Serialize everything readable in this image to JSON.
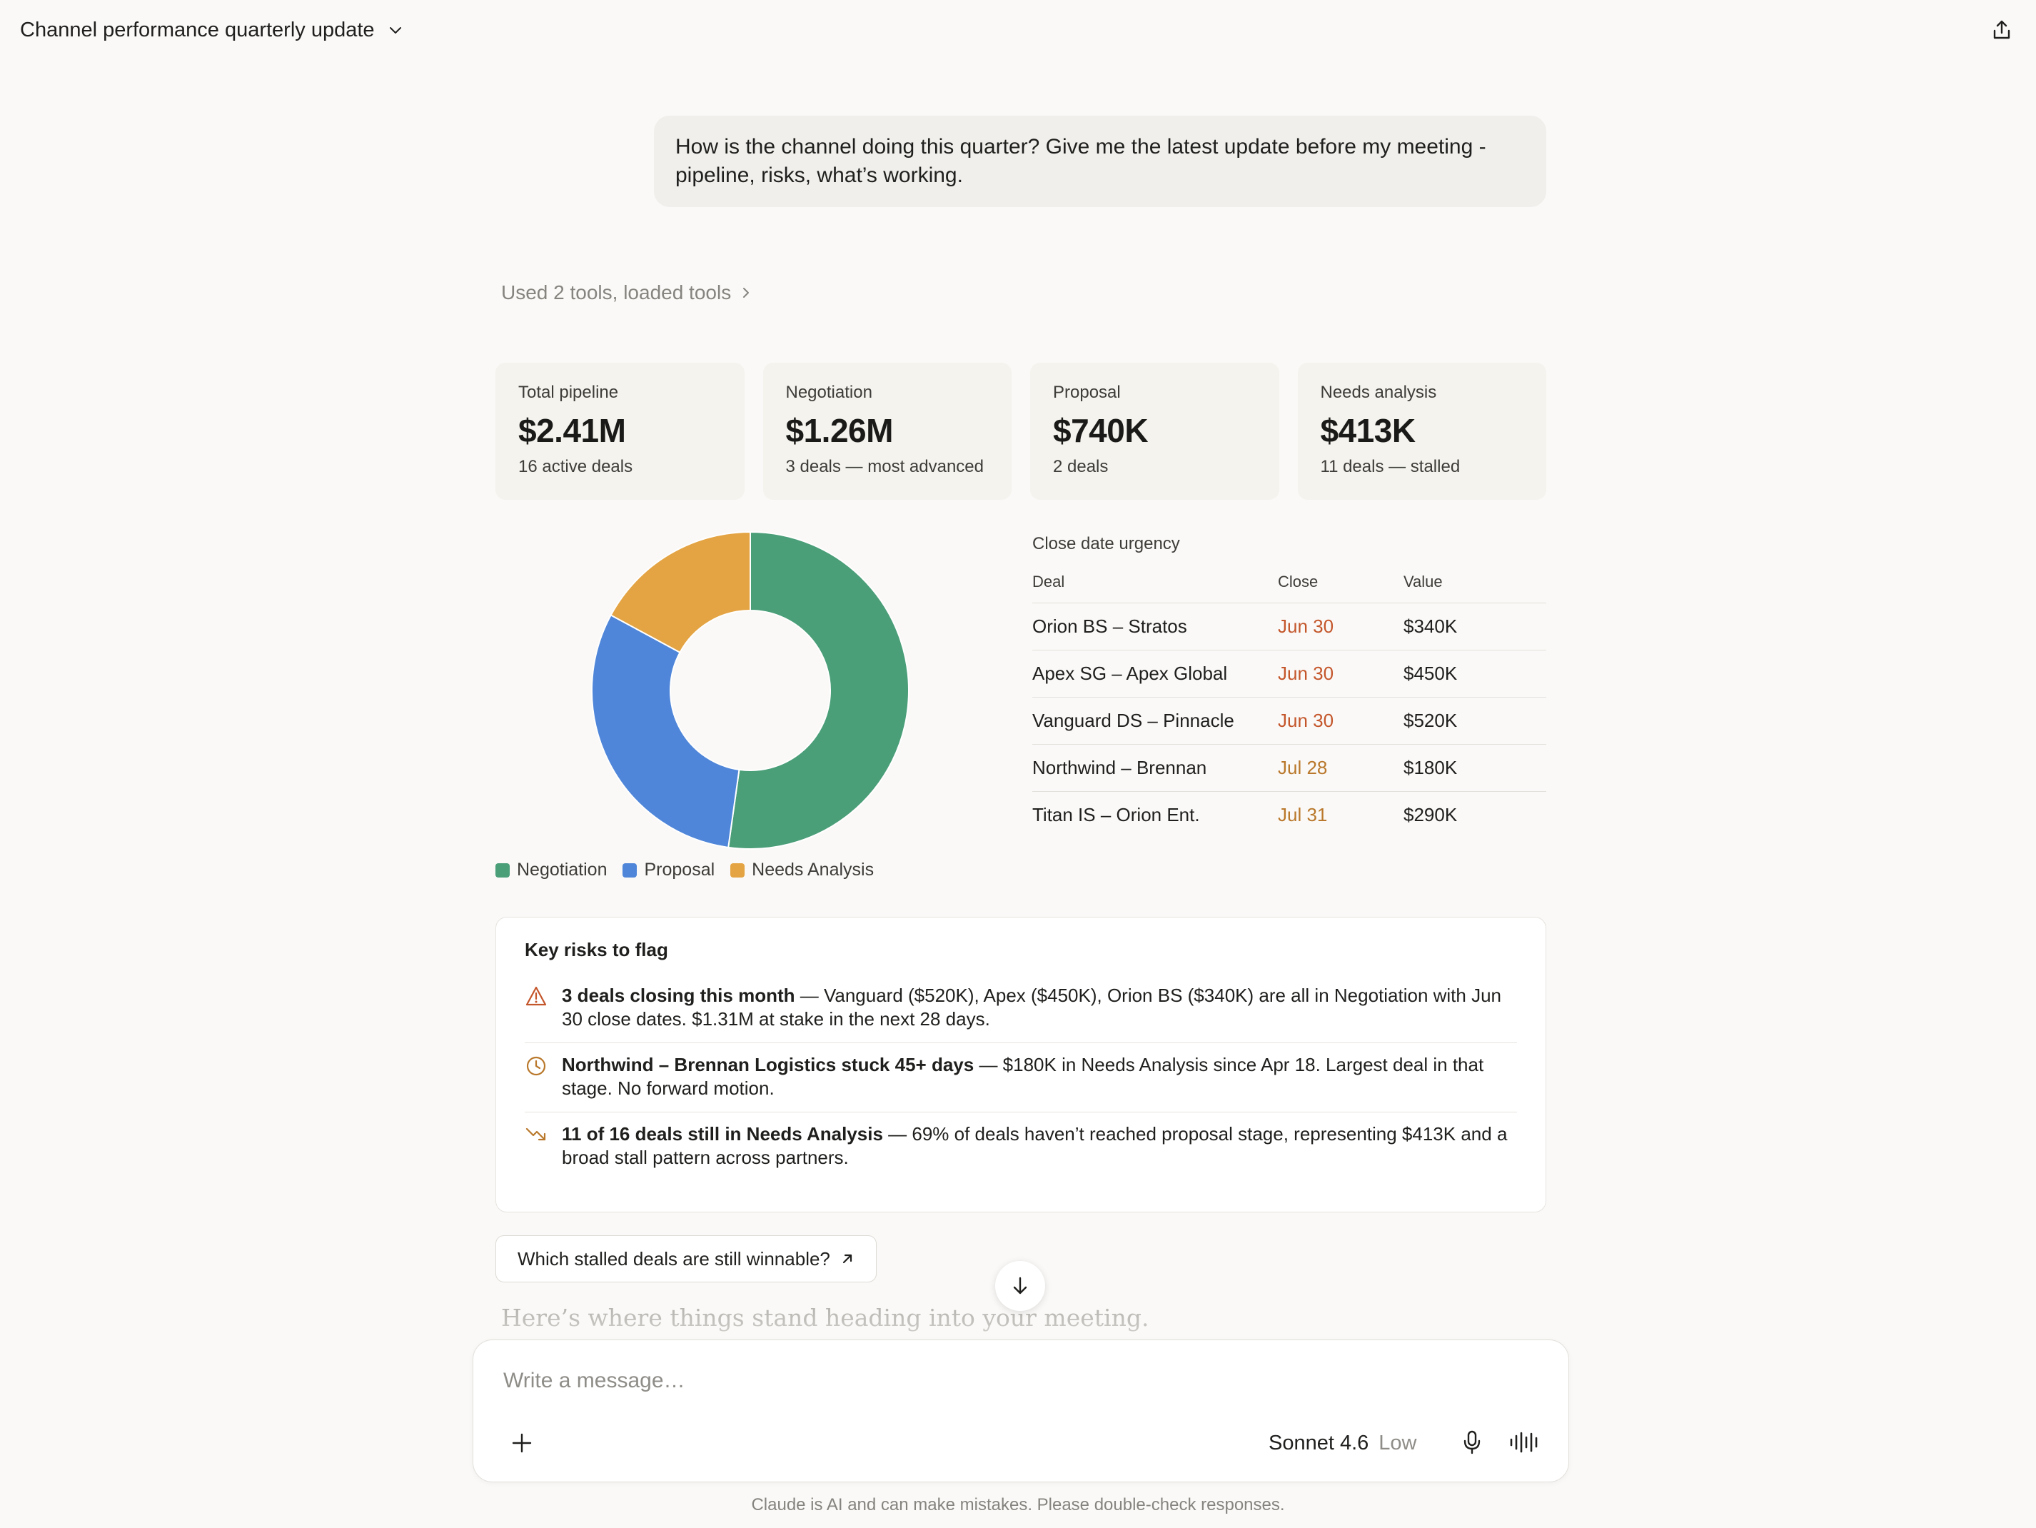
{
  "header": {
    "title": "Channel performance quarterly update"
  },
  "user_message": "How is the channel doing this quarter? Give me the latest update before my meeting - pipeline, risks, what’s working.",
  "tools_summary": "Used 2 tools, loaded tools",
  "kpis": [
    {
      "label": "Total pipeline",
      "value": "$2.41M",
      "sub": "16 active deals"
    },
    {
      "label": "Negotiation",
      "value": "$1.26M",
      "sub": "3 deals — most advanced"
    },
    {
      "label": "Proposal",
      "value": "$740K",
      "sub": "2 deals"
    },
    {
      "label": "Needs analysis",
      "value": "$413K",
      "sub": "11 deals — stalled"
    }
  ],
  "colors": {
    "negotiation": "#4a9e78",
    "proposal": "#4f86d9",
    "needs_analysis": "#e4a443",
    "urgent": "#c4562b",
    "soon": "#b9782b"
  },
  "chart_data": {
    "type": "pie",
    "categories": [
      "Negotiation",
      "Proposal",
      "Needs Analysis"
    ],
    "values": [
      1.26,
      0.74,
      0.413
    ],
    "legend": "bottom-left"
  },
  "urgency": {
    "title": "Close date urgency",
    "headers": [
      "Deal",
      "Close",
      "Value"
    ],
    "rows": [
      {
        "deal": "Orion BS – Stratos",
        "close": "Jun 30",
        "value": "$340K",
        "status": "urgent"
      },
      {
        "deal": "Apex SG – Apex Global",
        "close": "Jun 30",
        "value": "$450K",
        "status": "urgent"
      },
      {
        "deal": "Vanguard DS – Pinnacle",
        "close": "Jun 30",
        "value": "$520K",
        "status": "urgent"
      },
      {
        "deal": "Northwind – Brennan",
        "close": "Jul 28",
        "value": "$180K",
        "status": "soon"
      },
      {
        "deal": "Titan IS – Orion Ent.",
        "close": "Jul 31",
        "value": "$290K",
        "status": "soon"
      }
    ]
  },
  "risks": {
    "title": "Key risks to flag",
    "items": [
      {
        "icon": "warning-icon",
        "bold": "3 deals closing this month",
        "text": " — Vanguard ($520K), Apex ($450K), Orion BS ($340K) are all in Negotiation with Jun 30 close dates. $1.31M at stake in the next 28 days."
      },
      {
        "icon": "clock-icon",
        "bold": "Northwind – Brennan Logistics stuck 45+ days",
        "text": " — $180K in Needs Analysis since Apr 18. Largest deal in that stage. No forward motion."
      },
      {
        "icon": "trend-down-icon",
        "bold": "11 of 16 deals still in Needs Analysis",
        "text": " — 69% of deals haven’t reached proposal stage, representing $413K and a broad stall pattern across partners."
      }
    ]
  },
  "suggestion": "Which stalled deals are still winnable?",
  "response_preview": "Here’s where things stand heading into your meeting.",
  "composer": {
    "placeholder": "Write a message…",
    "model": "Sonnet 4.6",
    "effort": "Low"
  },
  "disclaimer": "Claude is AI and can make mistakes. Please double-check responses."
}
